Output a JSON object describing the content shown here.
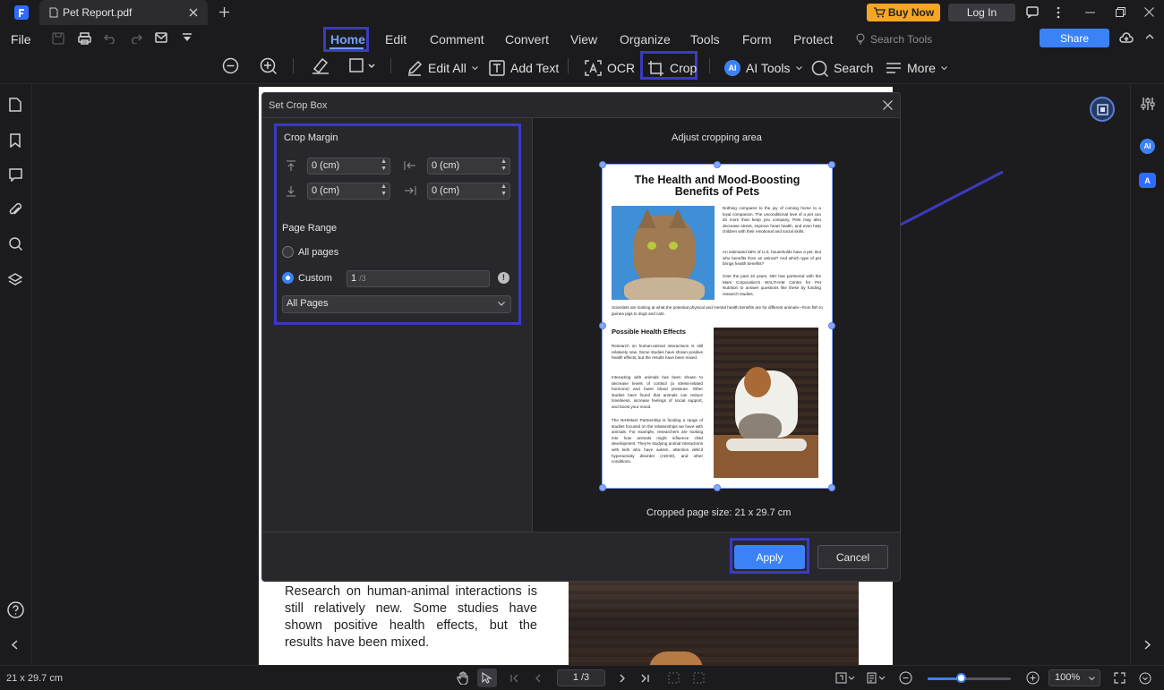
{
  "window": {
    "tab_title": "Pet Report.pdf",
    "buy_now": "Buy Now",
    "log_in": "Log In"
  },
  "menu": {
    "file": "File",
    "items": [
      "Home",
      "Edit",
      "Comment",
      "Convert",
      "View",
      "Organize",
      "Tools",
      "Form",
      "Protect"
    ],
    "search_tools": "Search Tools",
    "share": "Share"
  },
  "toolbar": {
    "edit_all": "Edit All",
    "add_text": "Add Text",
    "ocr": "OCR",
    "crop": "Crop",
    "ai_tools": "AI Tools",
    "search": "Search",
    "more": "More"
  },
  "dialog": {
    "title": "Set Crop Box",
    "crop_margin": "Crop Margin",
    "margin_top": "0 (cm)",
    "margin_left": "0 (cm)",
    "margin_bottom": "0 (cm)",
    "margin_right": "0 (cm)",
    "page_range": "Page Range",
    "all_pages": "All pages",
    "custom": "Custom",
    "custom_page": "1",
    "custom_total": "/3",
    "pages_select": "All Pages",
    "adjust_label": "Adjust cropping area",
    "cropped_size": "Cropped page size: 21 x 29.7 cm",
    "apply": "Apply",
    "cancel": "Cancel"
  },
  "preview": {
    "title": "The Health and Mood-Boosting Benefits of Pets",
    "para1": "Nothing compares to the joy of coming home to a loyal companion. The unconditional love of a pet can do more than keep you company. Pets may also decrease stress, improve heart health, and even help children with their emotional and social skills.",
    "para2": "An estimated 68% of U.S. households have a pet. But who benefits from an animal? And which type of pet brings health benefits?",
    "para3": "Over the past 10 years, NIH has partnered with the Mars Corporation's WALTHAM Centre for Pet Nutrition to answer questions like these by funding research studies.",
    "para4": "Scientists are looking at what the potential physical and mental health benefits are for different animals—from fish to guinea pigs to dogs and cats.",
    "heading2": "Possible Health Effects",
    "para5": "Research on human-animal interactions is still relatively new. Some studies have shown positive health effects, but the results have been mixed.",
    "para6": "Interacting with animals has been shown to decrease levels of cortisol (a stress-related hormone) and lower blood pressure. Other studies have found that animals can reduce loneliness, increase feelings of social support, and boost your mood.",
    "para7": "The NIH/Mars Partnership is funding a range of studies focused on the relationships we have with animals. For example, researchers are looking into how animals might influence child development. They're studying animal interactions with kids who have autism, attention deficit hyperactivity disorder (ADHD), and other conditions."
  },
  "document": {
    "visible_text": "Research on human-animal interactions is still relatively new. Some studies have shown positive health effects, but the results have been mixed."
  },
  "status": {
    "page_size": "21 x 29.7 cm",
    "page_indicator": "1 /3",
    "zoom": "100%",
    "zoom_level": 0.4
  },
  "colors": {
    "accent": "#3b82f6",
    "highlight": "#3b3bbf",
    "buy_now": "#f5a623"
  }
}
